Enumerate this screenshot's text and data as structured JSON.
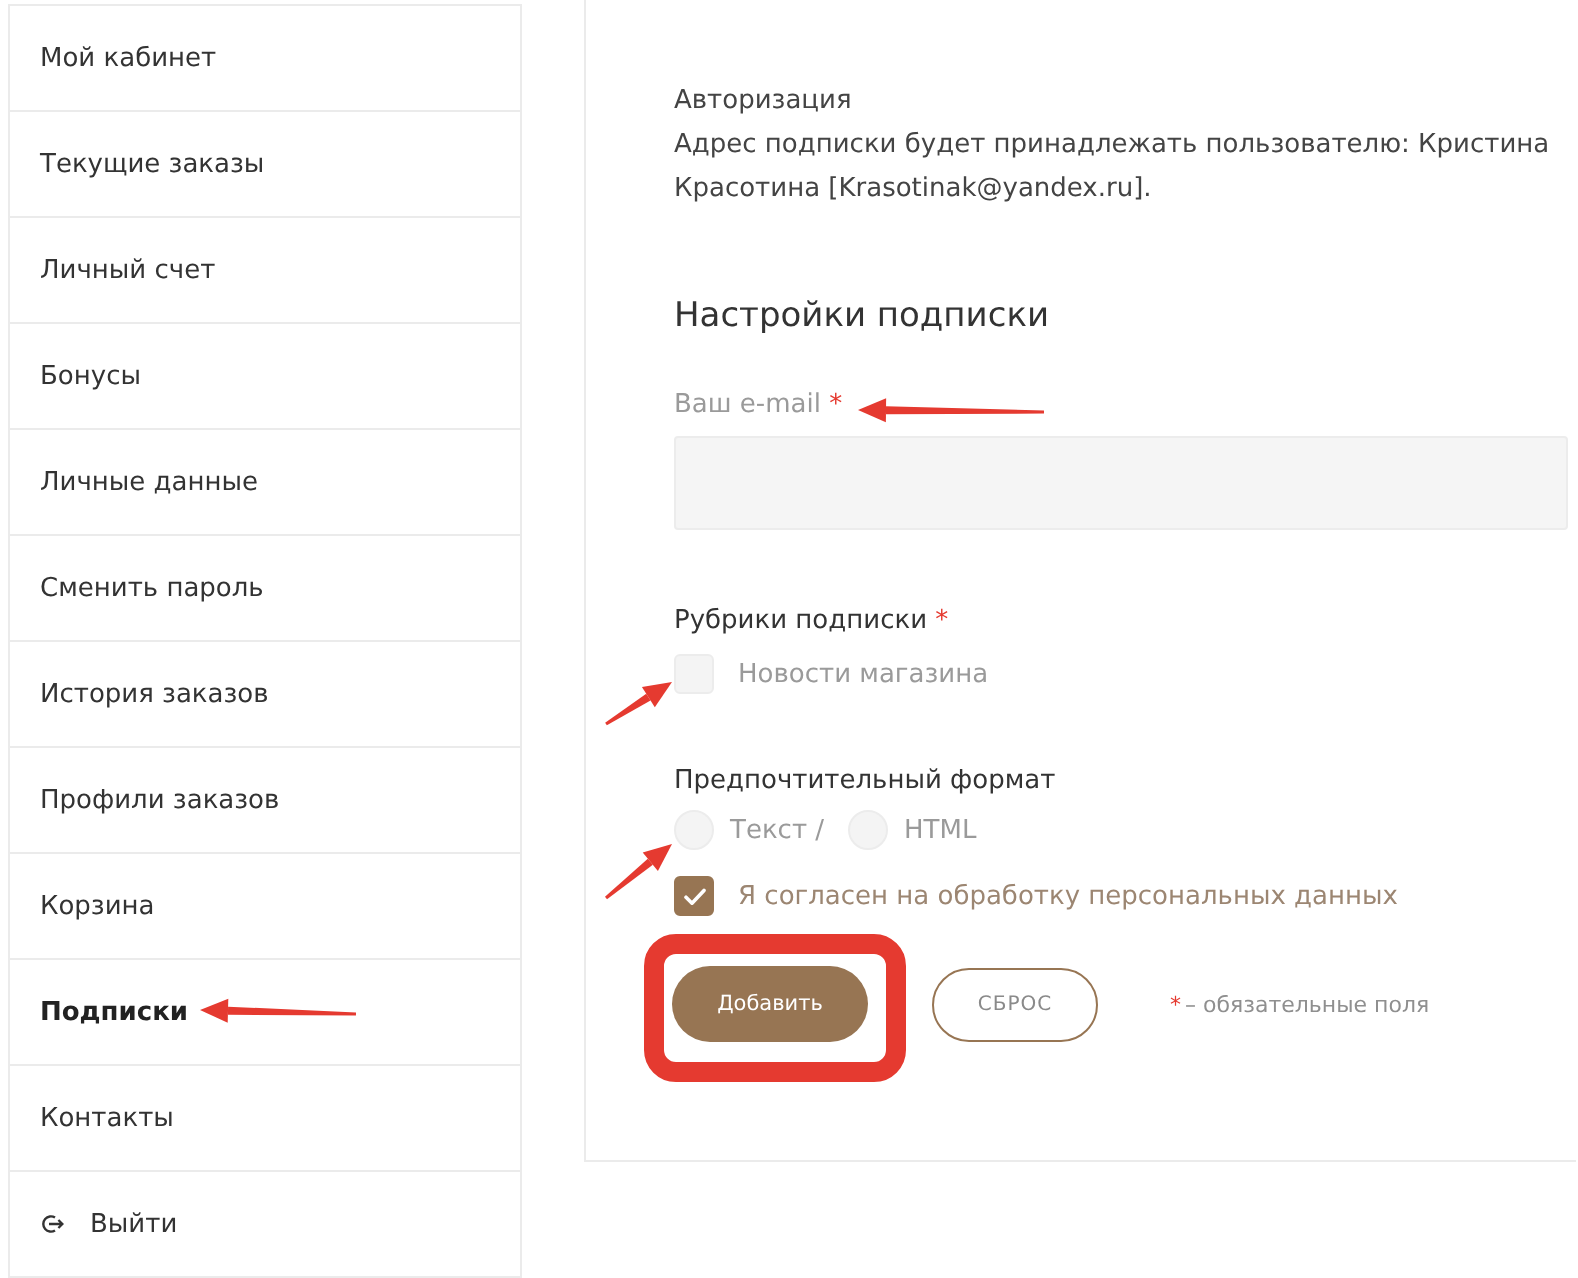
{
  "sidebar": {
    "items": [
      {
        "label": "Мой кабинет",
        "kind": "link",
        "selected": false
      },
      {
        "label": "Текущие заказы",
        "kind": "link",
        "selected": false
      },
      {
        "label": "Личный счет",
        "kind": "link",
        "selected": false
      },
      {
        "label": "Бонусы",
        "kind": "link",
        "selected": false
      },
      {
        "label": "Личные данные",
        "kind": "link",
        "selected": false
      },
      {
        "label": "Сменить пароль",
        "kind": "link",
        "selected": false
      },
      {
        "label": "История заказов",
        "kind": "link",
        "selected": false
      },
      {
        "label": "Профили заказов",
        "kind": "link",
        "selected": false
      },
      {
        "label": "Корзина",
        "kind": "link",
        "selected": false
      },
      {
        "label": "Подписки",
        "kind": "link",
        "selected": true
      },
      {
        "label": "Контакты",
        "kind": "link",
        "selected": false
      },
      {
        "label": "Выйти",
        "kind": "logout",
        "selected": false
      }
    ]
  },
  "subscription": {
    "auth_title": "Авторизация",
    "auth_text": "Адрес подписки будет принадлежать пользователю: Кристина Красотина [Krasotinak@yandex.ru].",
    "heading": "Настройки подписки",
    "email": {
      "label": "Ваш e-mail",
      "required_mark": "*"
    },
    "rubrics": {
      "label": "Рубрики подписки",
      "required_mark": "*",
      "options": [
        {
          "label": "Новости магазина",
          "checked": false
        }
      ]
    },
    "format": {
      "label": "Предпочтительный формат",
      "options": [
        {
          "label": "Текст /",
          "selected": false
        },
        {
          "label": "HTML",
          "selected": false
        }
      ]
    },
    "consent": {
      "label": "Я согласен на обработку персональных данных",
      "checked": true
    },
    "buttons": [
      {
        "label": "Добавить",
        "kind": "primary"
      },
      {
        "label": "СБРОС",
        "kind": "outline"
      }
    ],
    "required_note": {
      "mark": "*",
      "text": "– обязательные поля"
    }
  }
}
